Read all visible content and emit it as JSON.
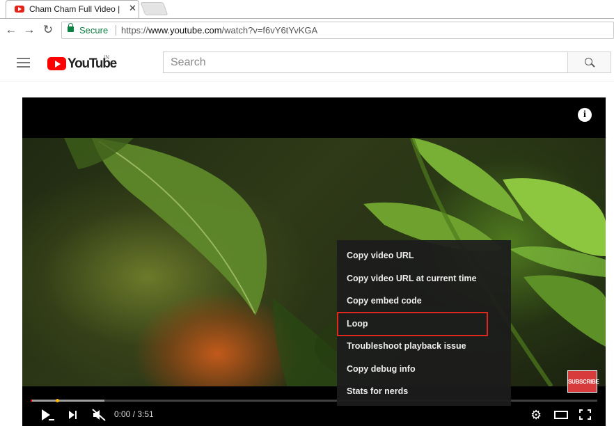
{
  "browser": {
    "tab_title": "Cham Cham Full Video |",
    "close_glyph": "✕",
    "secure_label": "Secure",
    "url_scheme": "https://",
    "url_host": "www.youtube.com",
    "url_path": "/watch?v=f6vY6tYvKGA"
  },
  "youtube": {
    "logo_text": "YouTube",
    "region": "IN",
    "search_placeholder": "Search"
  },
  "player": {
    "info_glyph": "i",
    "subscribe_label": "SUBSCRIBE",
    "current_time": "0:00",
    "time_separator": " / ",
    "duration": "3:51",
    "buffered_fraction": 0.13
  },
  "context_menu": {
    "items": [
      "Copy video URL",
      "Copy video URL at current time",
      "Copy embed code",
      "Loop",
      "Troubleshoot playback issue",
      "Copy debug info",
      "Stats for nerds"
    ],
    "highlighted_item": "Loop",
    "highlight_color": "#e1281e"
  },
  "colors": {
    "youtube_red": "#ff0000",
    "secure_green": "#0b8043"
  }
}
